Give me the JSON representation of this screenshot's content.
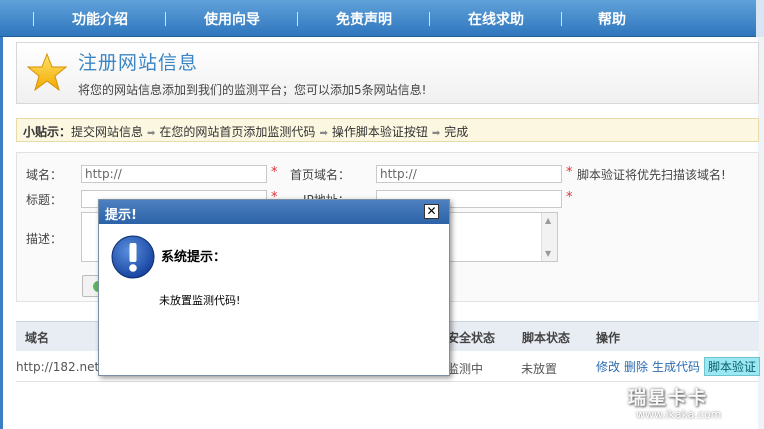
{
  "nav": {
    "items": [
      "功能介绍",
      "使用向导",
      "免责声明",
      "在线求助",
      "帮助"
    ]
  },
  "header": {
    "title": "注册网站信息",
    "description": "将您的网站信息添加到我们的监测平台；您可以添加5条网站信息!"
  },
  "tips": {
    "label": "小贴示：",
    "steps": [
      "提交网站信息",
      "在您的网站首页添加监测代码",
      "操作脚本验证按钮",
      "完成"
    ]
  },
  "form": {
    "domain_label": "域名：",
    "domain_value": "http://",
    "homepage_label": "首页域名：",
    "homepage_value": "http://",
    "required_mark": "*",
    "homepage_hint": "脚本验证将优先扫描该域名!",
    "title_label": "标题：",
    "ip_label": "IP地址：",
    "desc_label": "描述："
  },
  "table": {
    "headers": {
      "domain": "域名",
      "security": "安全状态",
      "script": "脚本状态",
      "actions": "操作"
    },
    "rows": [
      {
        "domain": "http://182.net",
        "security": "监测中",
        "script": "未放置",
        "edit": "修改",
        "delete": "删除",
        "gen_code": "生成代码",
        "verify": "脚本验证"
      }
    ]
  },
  "modal": {
    "title": "提示!",
    "close": "✕",
    "heading": "系统提示：",
    "message": "未放置监测代码!"
  },
  "watermark": {
    "line1": "瑞星卡卡",
    "line2": "www.ikaka.com"
  },
  "colors": {
    "nav": "#2f76bd",
    "accent_title": "#3b86c6",
    "modal_bar": "#2c62a8",
    "required": "#e03030",
    "verify_badge": "#9be8f2"
  }
}
